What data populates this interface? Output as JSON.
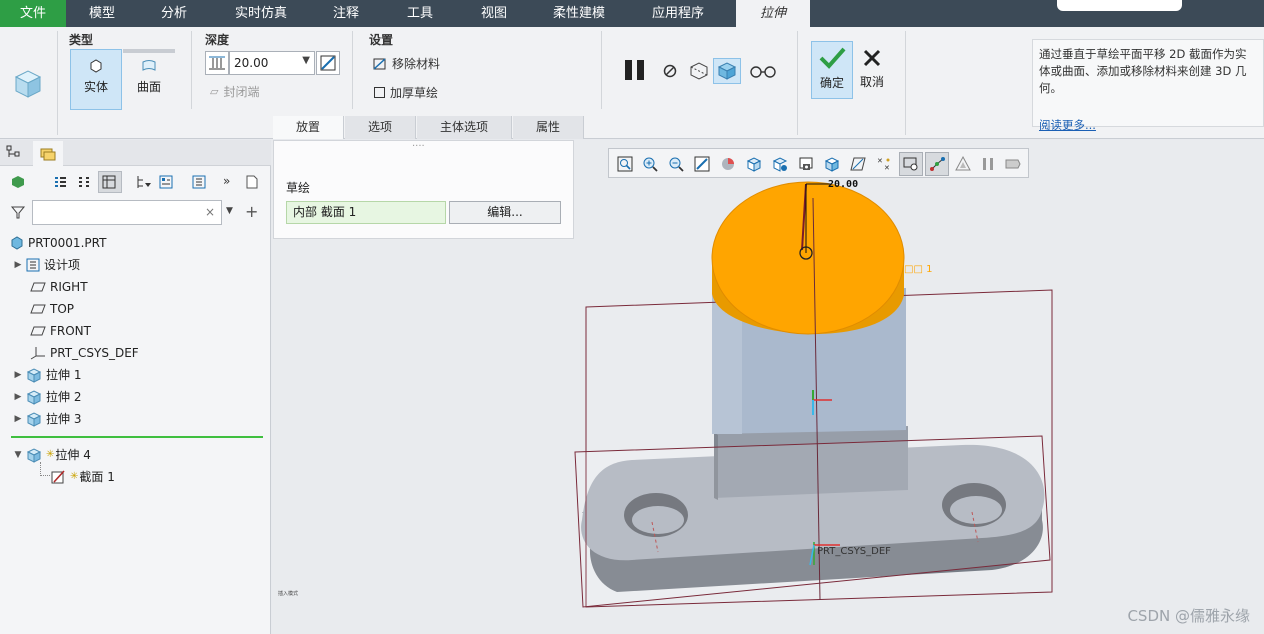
{
  "menu": {
    "items": [
      "文件",
      "模型",
      "分析",
      "实时仿真",
      "注释",
      "工具",
      "视图",
      "柔性建模",
      "应用程序",
      "拉伸"
    ]
  },
  "ribbon": {
    "type_group": {
      "title": "类型",
      "solid": "实体",
      "surface": "曲面"
    },
    "depth_group": {
      "title": "深度",
      "value": "20.00",
      "close_ends": "封闭端"
    },
    "settings_group": {
      "title": "设置",
      "remove_material": "移除材料",
      "thicken_sketch": "加厚草绘"
    },
    "ok_label": "确定",
    "cancel_label": "取消",
    "tabs": [
      "放置",
      "选项",
      "主体选项",
      "属性"
    ],
    "help_text": "通过垂直于草绘平面平移 2D 截面作为实体或曲面、添加或移除材料来创建 3D 几何。",
    "help_link": "阅读更多..."
  },
  "placement": {
    "label": "草绘",
    "section_value": "内部 截面 1",
    "edit_button": "编辑..."
  },
  "tree": {
    "root": "PRT0001.PRT",
    "items": [
      "设计项",
      "RIGHT",
      "TOP",
      "FRONT",
      "PRT_CSYS_DEF",
      "拉伸 1",
      "拉伸 2",
      "拉伸 3"
    ],
    "active_feature": "拉伸 4",
    "active_child": "截面 1"
  },
  "viewport": {
    "dimension_value": "20.00",
    "csys_label": "PRT_CSYS_DEF",
    "small_note": "插入模式",
    "watermark": "CSDN @儒雅永缘",
    "accent_color": "#ffa500"
  }
}
